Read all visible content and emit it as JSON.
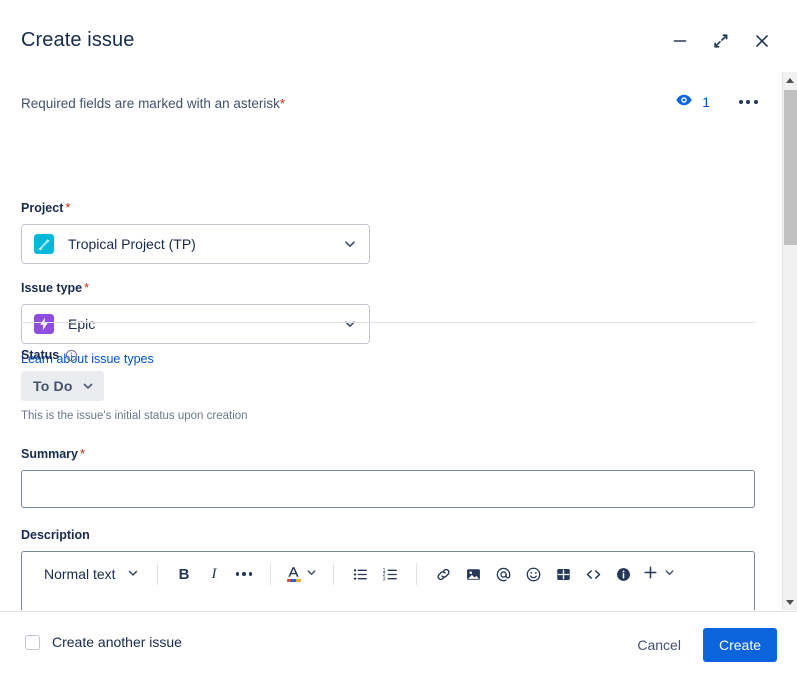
{
  "window": {
    "title": "Create issue",
    "controls": [
      {
        "name": "minimize",
        "label": "Minimize"
      },
      {
        "name": "collapse",
        "label": "Collapse"
      },
      {
        "name": "close",
        "label": "Close"
      }
    ]
  },
  "notice": {
    "text": "Required fields are marked with an asterisk",
    "asterisk": "*"
  },
  "watchers": {
    "icon": "eye-icon",
    "count": "1",
    "more_label": "More actions"
  },
  "fields": {
    "project": {
      "label": "Project",
      "required": "*",
      "value": "Tropical Project (TP)",
      "avatar_name": "project-avatar-tropical",
      "avatar_color": "#00B8D9"
    },
    "issue_type": {
      "label": "Issue type",
      "required": "*",
      "value": "Epic",
      "avatar_name": "epic-icon",
      "avatar_color": "#8F4EE0",
      "help_link": "Learn about issue types"
    },
    "status": {
      "label": "Status",
      "info_icon": "info-circle-icon",
      "value": "To Do",
      "help_text": "This is the issue's initial status upon creation"
    },
    "summary": {
      "label": "Summary",
      "required": "*",
      "value": "",
      "placeholder": ""
    },
    "description": {
      "label": "Description",
      "value": "",
      "toolbar": {
        "text_style": "Normal text",
        "buttons": [
          {
            "name": "bold-button",
            "label": "B"
          },
          {
            "name": "italic-button",
            "label": "I"
          },
          {
            "name": "more-formatting-button",
            "label": "..."
          },
          {
            "name": "text-color-button",
            "label": "A"
          },
          {
            "name": "bullet-list-button",
            "label": "Bulleted list"
          },
          {
            "name": "numbered-list-button",
            "label": "Numbered list"
          },
          {
            "name": "link-button",
            "label": "Link"
          },
          {
            "name": "image-button",
            "label": "Image"
          },
          {
            "name": "mention-button",
            "label": "Mention"
          },
          {
            "name": "emoji-button",
            "label": "Emoji"
          },
          {
            "name": "table-button",
            "label": "Table"
          },
          {
            "name": "code-button",
            "label": "Code snippet"
          },
          {
            "name": "info-panel-button",
            "label": "Info panel"
          },
          {
            "name": "insert-more-button",
            "label": "Insert more"
          }
        ]
      }
    }
  },
  "footer": {
    "create_another_label": "Create another issue",
    "create_another_checked": false,
    "cancel_label": "Cancel",
    "create_label": "Create"
  },
  "colors": {
    "accent_blue": "#0B64DC",
    "link_blue": "#0052CC",
    "required_red": "#BF2600",
    "text_primary": "#172B4D",
    "text_subtle": "#6B778C"
  }
}
